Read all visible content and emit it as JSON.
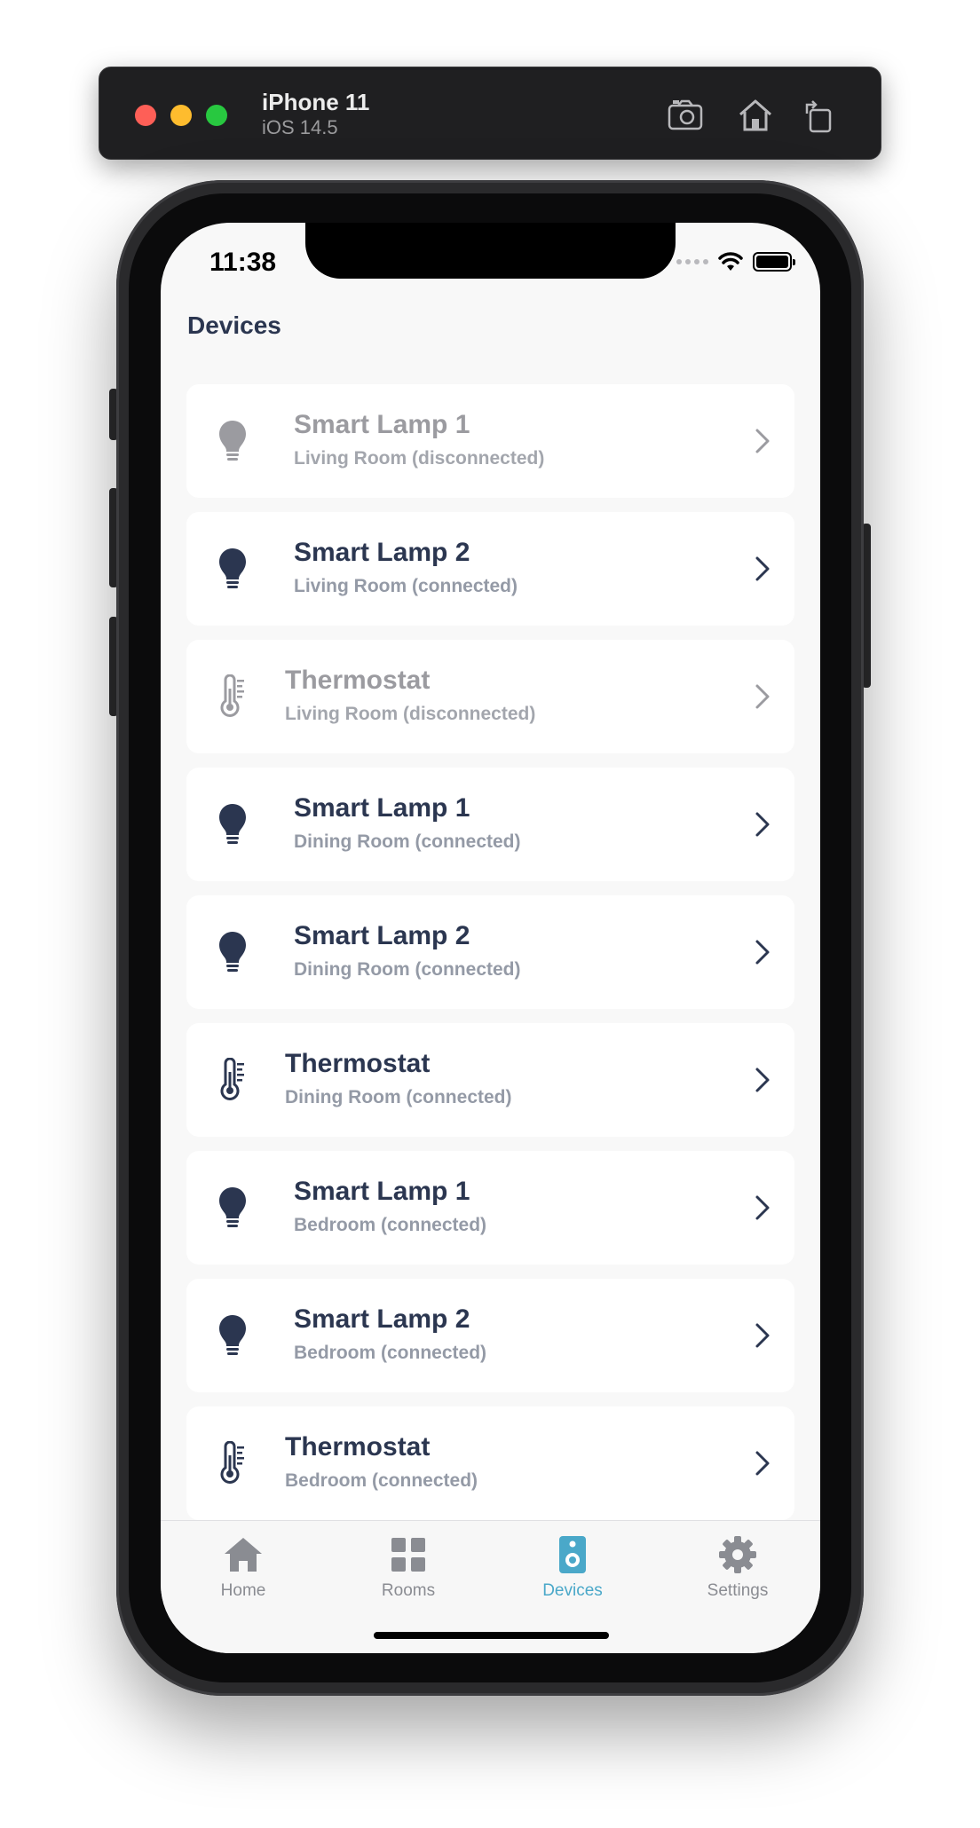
{
  "simulator": {
    "device_name": "iPhone 11",
    "os_version": "iOS 14.5",
    "toolbar_icons": [
      "screenshot-icon",
      "home-icon",
      "rotate-icon"
    ]
  },
  "status_bar": {
    "time": "11:38"
  },
  "page": {
    "title": "Devices"
  },
  "devices": [
    {
      "name": "Smart Lamp 1",
      "subtitle": "Living Room (disconnected)",
      "icon": "lightbulb-icon",
      "connected": false
    },
    {
      "name": "Smart Lamp 2",
      "subtitle": "Living Room (connected)",
      "icon": "lightbulb-icon",
      "connected": true
    },
    {
      "name": "Thermostat",
      "subtitle": "Living Room (disconnected)",
      "icon": "thermometer-icon",
      "connected": false
    },
    {
      "name": "Smart Lamp 1",
      "subtitle": "Dining Room (connected)",
      "icon": "lightbulb-icon",
      "connected": true
    },
    {
      "name": "Smart Lamp 2",
      "subtitle": "Dining Room (connected)",
      "icon": "lightbulb-icon",
      "connected": true
    },
    {
      "name": "Thermostat",
      "subtitle": "Dining Room (connected)",
      "icon": "thermometer-icon",
      "connected": true
    },
    {
      "name": "Smart Lamp 1",
      "subtitle": "Bedroom (connected)",
      "icon": "lightbulb-icon",
      "connected": true
    },
    {
      "name": "Smart Lamp 2",
      "subtitle": "Bedroom (connected)",
      "icon": "lightbulb-icon",
      "connected": true
    },
    {
      "name": "Thermostat",
      "subtitle": "Bedroom (connected)",
      "icon": "thermometer-icon",
      "connected": true
    }
  ],
  "tab_bar": {
    "tabs": [
      {
        "label": "Home",
        "icon": "house-icon",
        "active": false
      },
      {
        "label": "Rooms",
        "icon": "grid-icon",
        "active": false
      },
      {
        "label": "Devices",
        "icon": "speaker-icon",
        "active": true
      },
      {
        "label": "Settings",
        "icon": "gear-icon",
        "active": false
      }
    ]
  },
  "colors": {
    "text_primary": "#2b3650",
    "text_disabled": "#9b9ba0",
    "accent": "#4aa8c9",
    "tab_inactive": "#8a8c92"
  }
}
